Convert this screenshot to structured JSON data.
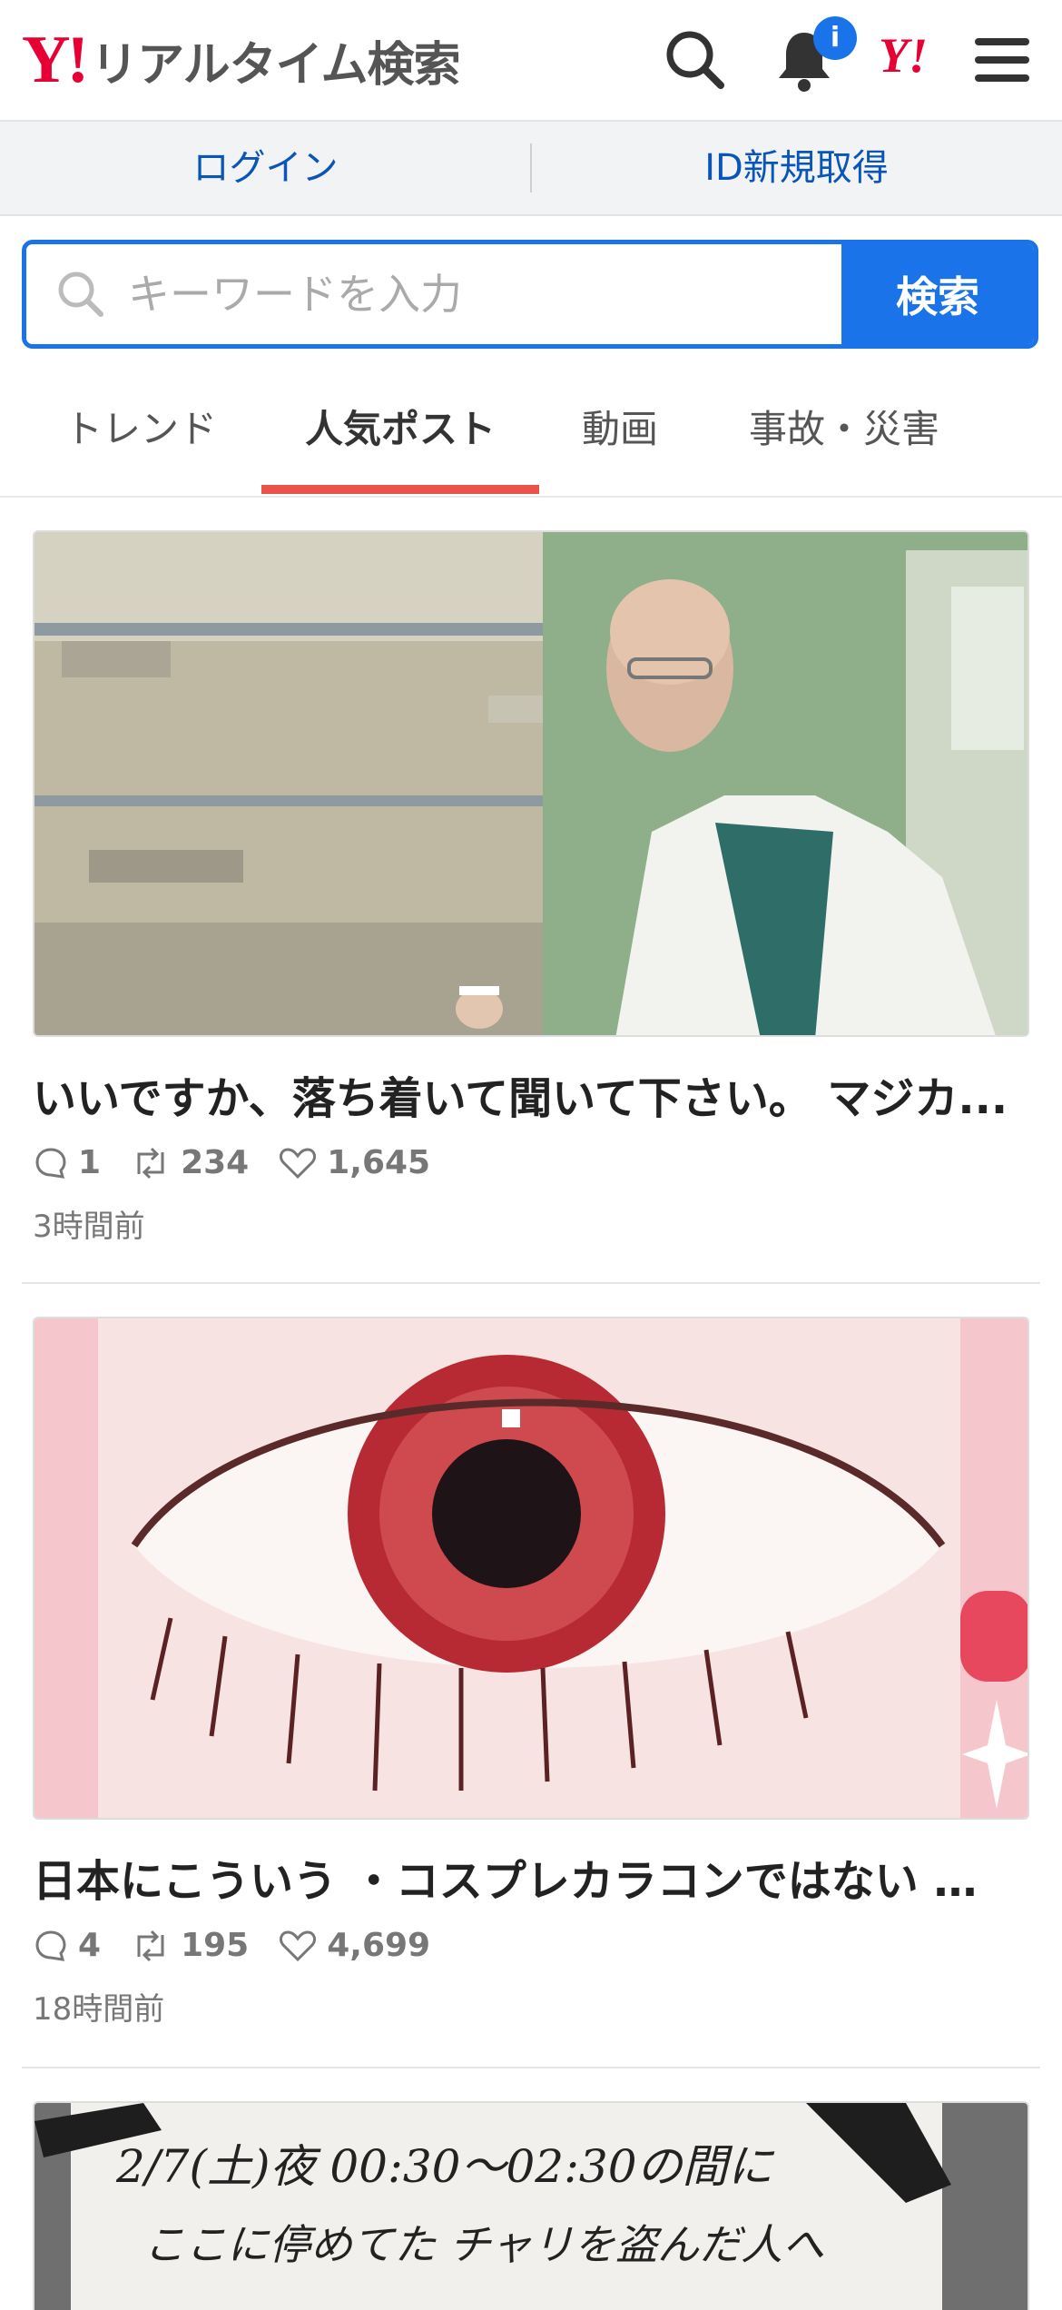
{
  "header": {
    "logo_mark": "Y!",
    "logo_text": "リアルタイム検索",
    "notification_badge": "i",
    "yahoo_mark": "Y!"
  },
  "auth": {
    "login": "ログイン",
    "register": "ID新規取得"
  },
  "search": {
    "placeholder": "キーワードを入力",
    "button": "検索"
  },
  "tabs": [
    {
      "label": "トレンド"
    },
    {
      "label": "人気ポスト"
    },
    {
      "label": "動画"
    },
    {
      "label": "事故・災害"
    }
  ],
  "posts": [
    {
      "title": "いいですか、落ち着いて聞いて下さい。 マジカ...",
      "replies": "1",
      "reposts": "234",
      "likes": "1,645",
      "time": "3時間前"
    },
    {
      "title": "日本にこういう ・コスプレカラコンではない ・...",
      "replies": "4",
      "reposts": "195",
      "likes": "4,699",
      "time": "18時間前"
    },
    {
      "image_text_line1": "2/7(土)夜 00:30〜02:30の間に",
      "image_text_line2": "ここに停めてた チャリを盗んだ人へ"
    }
  ],
  "colors": {
    "brand_red": "#e60033",
    "accent_blue": "#1a73e8",
    "tab_underline": "#e8534a"
  }
}
